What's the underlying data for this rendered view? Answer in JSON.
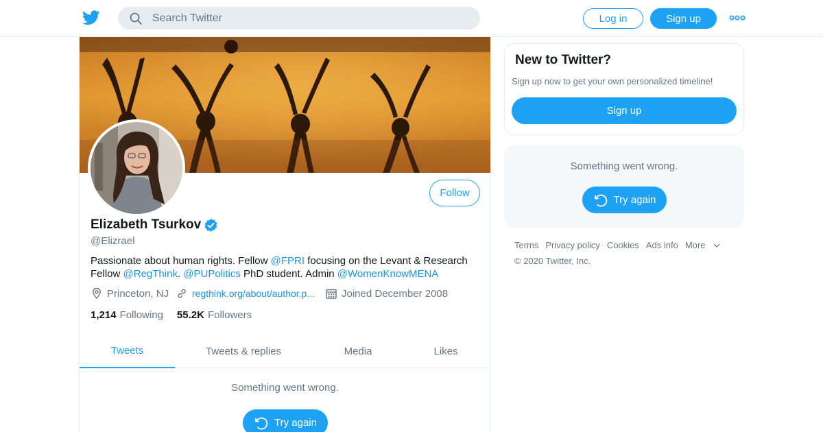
{
  "header": {
    "search_placeholder": "Search Twitter",
    "login_label": "Log in",
    "signup_label": "Sign up",
    "brand_color": "#1da1f2"
  },
  "profile": {
    "name": "Elizabeth Tsurkov",
    "handle": "@Elizrael",
    "follow_label": "Follow",
    "bio": {
      "t1": "Passionate about human rights. Fellow ",
      "m1": "@FPRI",
      "t2": " focusing on the Levant & Research Fellow ",
      "m2": "@RegThink",
      "t3": ". ",
      "m3": "@PUPolitics",
      "t4": " PhD student. Admin ",
      "m4": "@WomenKnowMENA"
    },
    "location": "Princeton, NJ",
    "website": "regthink.org/about/author.p...",
    "joined": "Joined December 2008",
    "following_count": "1,214",
    "following_label": "Following",
    "followers_count": "55.2K",
    "followers_label": "Followers"
  },
  "tabs": [
    {
      "label": "Tweets",
      "active": true
    },
    {
      "label": "Tweets & replies",
      "active": false
    },
    {
      "label": "Media",
      "active": false
    },
    {
      "label": "Likes",
      "active": false
    }
  ],
  "timeline": {
    "error": "Something went wrong.",
    "retry_label": "Try again"
  },
  "sidebar": {
    "new_title": "New to Twitter?",
    "new_sub": "Sign up now to get your own personalized timeline!",
    "signup_label": "Sign up",
    "error": "Something went wrong.",
    "retry_label": "Try again"
  },
  "footer": {
    "links": [
      "Terms",
      "Privacy policy",
      "Cookies",
      "Ads info",
      "More"
    ],
    "copyright": "© 2020 Twitter, Inc."
  }
}
